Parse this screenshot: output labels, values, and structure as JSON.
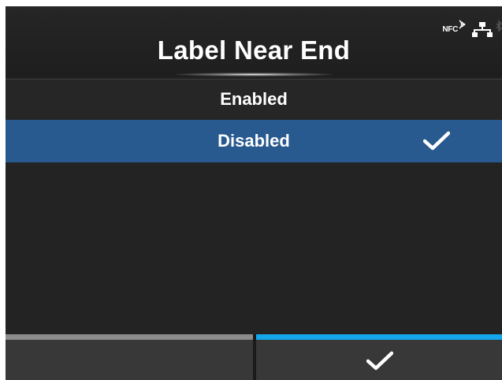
{
  "header": {
    "title": "Label Near End",
    "status_icons": {
      "nfc_label": "NFC",
      "icons": [
        "nfc-icon",
        "network-icon",
        "bluetooth-icon"
      ]
    }
  },
  "options": [
    {
      "label": "Enabled",
      "selected": false
    },
    {
      "label": "Disabled",
      "selected": true
    }
  ],
  "footer": {
    "left_button": {
      "label": ""
    },
    "right_button": {
      "icon": "checkmark-icon"
    }
  },
  "colors": {
    "background": "#232323",
    "selected_row": "#28598f",
    "confirm_accent": "#14a6ea",
    "back_accent": "#8c8c8c",
    "text": "#ffffff"
  }
}
